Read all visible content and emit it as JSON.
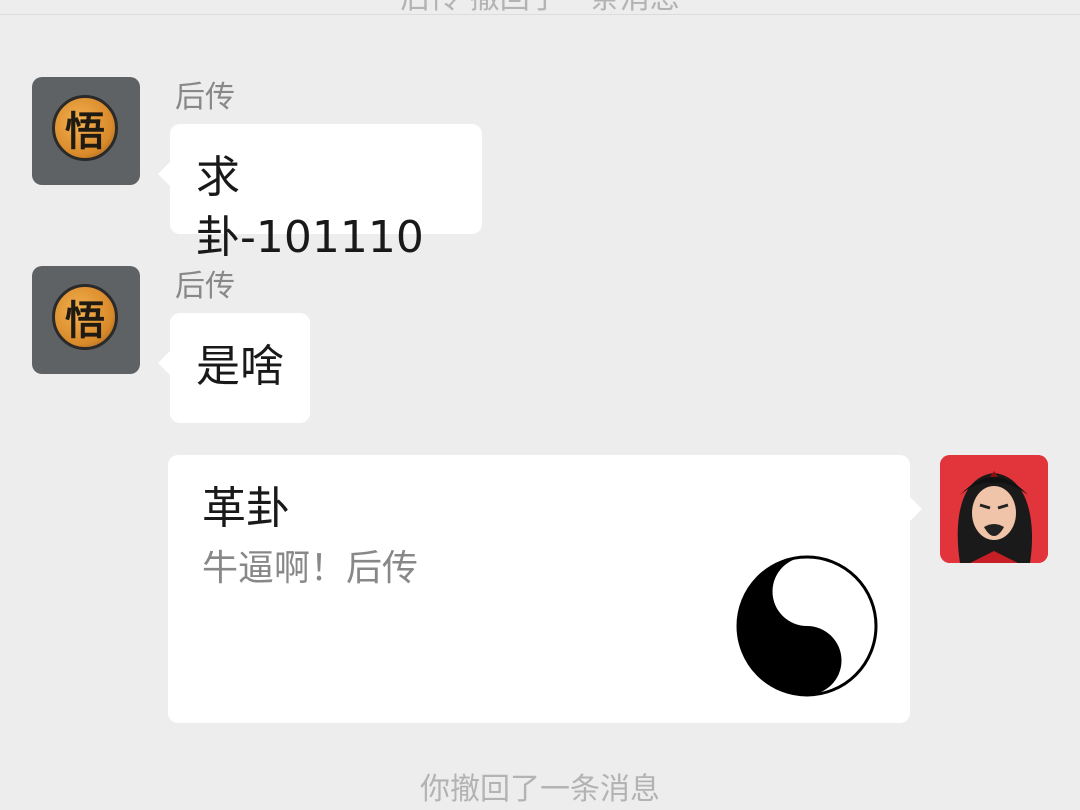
{
  "system_notices": {
    "top": "后传 撤回了一条消息",
    "bottom": "你撤回了一条消息"
  },
  "messages": [
    {
      "sender": "后传",
      "text": "求卦-101110",
      "side": "left",
      "avatar_char": "悟"
    },
    {
      "sender": "后传",
      "text": "是啥",
      "side": "left",
      "avatar_char": "悟"
    }
  ],
  "share_card": {
    "title": "革卦",
    "description": "牛逼啊！后传",
    "thumbnail_icon": "yin-yang-icon",
    "side": "right"
  },
  "colors": {
    "background": "#ededed",
    "bubble": "#ffffff",
    "my_avatar": "#e2343b"
  }
}
